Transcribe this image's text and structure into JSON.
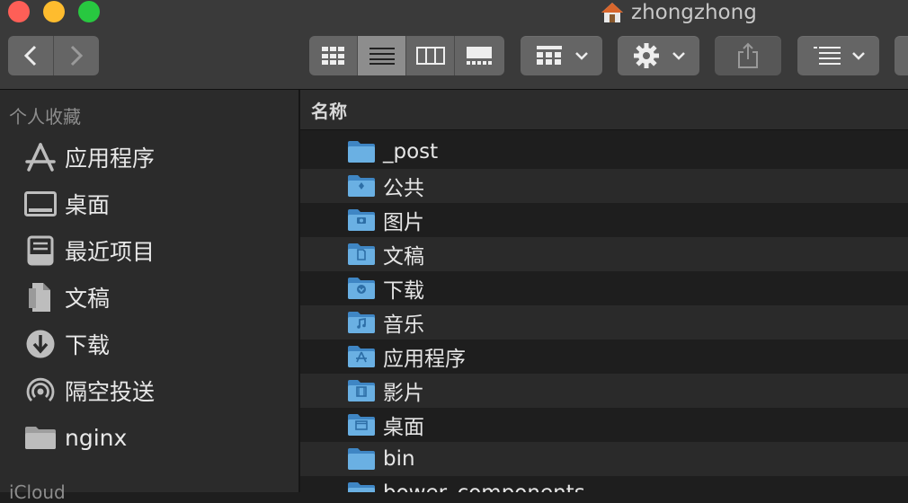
{
  "window": {
    "title": "zhongzhong",
    "title_icon": "home-icon"
  },
  "toolbar": {
    "back": "chevron-left-icon",
    "forward": "chevron-right-icon",
    "view_modes": [
      "icon-view-icon",
      "list-view-icon",
      "column-view-icon",
      "gallery-view-icon"
    ],
    "active_view": "list-view-icon",
    "group_by": "group-grid-icon",
    "action": "gear-icon",
    "share": "share-icon",
    "arrange": "arrange-list-icon"
  },
  "sidebar": {
    "heading": "个人收藏",
    "items": [
      {
        "label": "应用程序",
        "icon": "applications-icon"
      },
      {
        "label": "桌面",
        "icon": "desktop-icon"
      },
      {
        "label": "最近项目",
        "icon": "recents-icon"
      },
      {
        "label": "文稿",
        "icon": "documents-icon"
      },
      {
        "label": "下载",
        "icon": "downloads-icon"
      },
      {
        "label": "隔空投送",
        "icon": "airdrop-icon"
      },
      {
        "label": "nginx",
        "icon": "folder-icon"
      }
    ],
    "next_heading_partial": "iCloud"
  },
  "filelist": {
    "column_header": "名称",
    "rows": [
      {
        "name": "_post",
        "icon": "folder-icon"
      },
      {
        "name": "公共",
        "icon": "public-folder-icon"
      },
      {
        "name": "图片",
        "icon": "pictures-folder-icon"
      },
      {
        "name": "文稿",
        "icon": "documents-folder-icon"
      },
      {
        "name": "下载",
        "icon": "downloads-folder-icon"
      },
      {
        "name": "音乐",
        "icon": "music-folder-icon"
      },
      {
        "name": "应用程序",
        "icon": "applications-folder-icon"
      },
      {
        "name": "影片",
        "icon": "movies-folder-icon"
      },
      {
        "name": "桌面",
        "icon": "desktop-folder-icon"
      },
      {
        "name": "bin",
        "icon": "folder-icon"
      },
      {
        "name": "bower_components",
        "icon": "folder-icon"
      }
    ]
  },
  "colors": {
    "folder": "#6ab0e3",
    "folder_dark": "#3f86c4",
    "toolbar_bg": "#3a3a3a",
    "sidebar_bg": "#2b2b2b",
    "list_bg": "#1e1e1e",
    "row_alt": "#2a2a2a"
  }
}
